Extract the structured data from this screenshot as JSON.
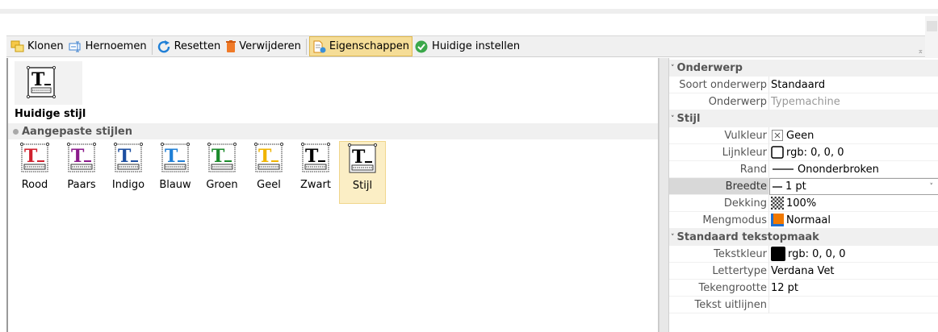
{
  "toolbar": {
    "clone": "Klonen",
    "rename": "Hernoemen",
    "reset": "Resetten",
    "delete": "Verwijderen",
    "properties": "Eigenschappen",
    "set_current": "Huidige instellen"
  },
  "left": {
    "current_style_label": "Huidige stijl",
    "custom_group_label": "Aangepaste stijlen",
    "styles": [
      {
        "label": "Rood",
        "color": "#d0202e"
      },
      {
        "label": "Paars",
        "color": "#8b1a8b"
      },
      {
        "label": "Indigo",
        "color": "#1e4fa0"
      },
      {
        "label": "Blauw",
        "color": "#1f7fd6"
      },
      {
        "label": "Groen",
        "color": "#1a8a2a"
      },
      {
        "label": "Geel",
        "color": "#f0b400"
      },
      {
        "label": "Zwart",
        "color": "#000000"
      },
      {
        "label": "Stijl",
        "color": "#000000"
      }
    ]
  },
  "props": {
    "cat_subject": "Onderwerp",
    "subject_type_name": "Soort onderwerp",
    "subject_type_val": "Standaard",
    "subject_name": "Onderwerp",
    "subject_val": "Typemachine",
    "cat_style": "Stijl",
    "fill_name": "Vulkleur",
    "fill_val": "Geen",
    "line_name": "Lijnkleur",
    "line_val": "rgb: 0, 0, 0",
    "border_name": "Rand",
    "border_val": "Ononderbroken",
    "width_name": "Breedte",
    "width_val": "1 pt",
    "opacity_name": "Dekking",
    "opacity_val": "100%",
    "blend_name": "Mengmodus",
    "blend_val": "Normaal",
    "cat_text": "Standaard tekstopmaak",
    "textcolor_name": "Tekstkleur",
    "textcolor_val": "rgb: 0, 0, 0",
    "font_name": "Lettertype",
    "font_val": "Verdana Vet",
    "size_name": "Tekengrootte",
    "size_val": "12 pt",
    "align_name": "Tekst uitlijnen",
    "align_val": ""
  },
  "colors": {
    "toolbar_bg": "#f0f0f0",
    "active_btn": "#f5dd97",
    "selected_item": "#fbeec5",
    "blend_swatch": "#f07800"
  }
}
